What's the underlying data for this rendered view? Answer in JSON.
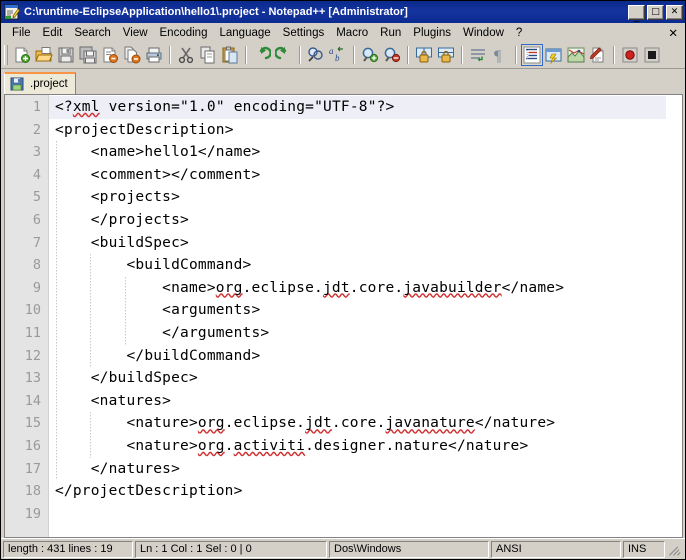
{
  "window": {
    "title": "C:\\runtime-EclipseApplication\\hello1\\.project - Notepad++ [Administrator]",
    "icon": "notepad-plus-plus-icon",
    "minimize_label": "_",
    "maximize_label": "□",
    "close_label": "✕",
    "titlebar_color": "#0a246a"
  },
  "menubar": {
    "items": [
      {
        "label": "File"
      },
      {
        "label": "Edit"
      },
      {
        "label": "Search"
      },
      {
        "label": "View"
      },
      {
        "label": "Encoding"
      },
      {
        "label": "Language"
      },
      {
        "label": "Settings"
      },
      {
        "label": "Macro"
      },
      {
        "label": "Run"
      },
      {
        "label": "Plugins"
      },
      {
        "label": "Window"
      },
      {
        "label": "?"
      }
    ],
    "close_document_label": "✕"
  },
  "toolbar": {
    "buttons": [
      {
        "name": "new-file-icon",
        "title": "New"
      },
      {
        "name": "open-file-icon",
        "title": "Open"
      },
      {
        "name": "save-icon",
        "title": "Save"
      },
      {
        "name": "save-all-icon",
        "title": "Save All"
      },
      {
        "name": "close-file-icon",
        "title": "Close"
      },
      {
        "name": "close-all-files-icon",
        "title": "Close All"
      },
      {
        "name": "print-icon",
        "title": "Print"
      },
      {
        "name": "cut-icon",
        "title": "Cut"
      },
      {
        "name": "copy-icon",
        "title": "Copy"
      },
      {
        "name": "paste-icon",
        "title": "Paste"
      },
      {
        "name": "undo-icon",
        "title": "Undo"
      },
      {
        "name": "redo-icon",
        "title": "Redo"
      },
      {
        "name": "find-icon",
        "title": "Find"
      },
      {
        "name": "replace-icon",
        "title": "Replace"
      },
      {
        "name": "zoom-in-icon",
        "title": "Zoom In"
      },
      {
        "name": "zoom-out-icon",
        "title": "Zoom Out"
      },
      {
        "name": "sync-vertical-scroll-icon",
        "title": "Synchronize Vertical Scrolling"
      },
      {
        "name": "sync-horizontal-scroll-icon",
        "title": "Synchronize Horizontal Scrolling"
      },
      {
        "name": "word-wrap-icon",
        "title": "Word wrap"
      },
      {
        "name": "show-all-characters-icon",
        "title": "Show All Characters"
      },
      {
        "name": "indent-guideline-icon",
        "title": "Show Indent Guide"
      },
      {
        "name": "user-defined-dialog-icon",
        "title": "User-Defined Dialogue"
      },
      {
        "name": "document-map-icon",
        "title": "Document Map"
      },
      {
        "name": "function-list-icon",
        "title": "Function List"
      },
      {
        "name": "start-record-macro-icon",
        "title": "Start Recording"
      },
      {
        "name": "stop-record-macro-icon",
        "title": "Stop Recording"
      }
    ]
  },
  "tabs": [
    {
      "label": ".project",
      "icon": "saved-document-icon",
      "active": true
    }
  ],
  "editor": {
    "current_line": 1,
    "current_line_highlight_color": "#eeeef7",
    "gutter_background": "#e4e4e4",
    "lines": [
      {
        "num": "1",
        "text": "<?xml version=\"1.0\" encoding=\"UTF-8\"?>",
        "indent": 0
      },
      {
        "num": "2",
        "text": "<projectDescription>",
        "indent": 0
      },
      {
        "num": "3",
        "text": "    <name>hello1</name>",
        "indent": 1
      },
      {
        "num": "4",
        "text": "    <comment></comment>",
        "indent": 1
      },
      {
        "num": "5",
        "text": "    <projects>",
        "indent": 1
      },
      {
        "num": "6",
        "text": "    </projects>",
        "indent": 1
      },
      {
        "num": "7",
        "text": "    <buildSpec>",
        "indent": 1
      },
      {
        "num": "8",
        "text": "        <buildCommand>",
        "indent": 2
      },
      {
        "num": "9",
        "text": "            <name>org.eclipse.jdt.core.javabuilder</name>",
        "indent": 3
      },
      {
        "num": "10",
        "text": "            <arguments>",
        "indent": 3
      },
      {
        "num": "11",
        "text": "            </arguments>",
        "indent": 3
      },
      {
        "num": "12",
        "text": "        </buildCommand>",
        "indent": 2
      },
      {
        "num": "13",
        "text": "    </buildSpec>",
        "indent": 1
      },
      {
        "num": "14",
        "text": "    <natures>",
        "indent": 1
      },
      {
        "num": "15",
        "text": "        <nature>org.eclipse.jdt.core.javanature</nature>",
        "indent": 2
      },
      {
        "num": "16",
        "text": "        <nature>org.activiti.designer.nature</nature>",
        "indent": 2
      },
      {
        "num": "17",
        "text": "    </natures>",
        "indent": 1
      },
      {
        "num": "18",
        "text": "</projectDescription>",
        "indent": 0
      },
      {
        "num": "19",
        "text": "",
        "indent": 0
      }
    ]
  },
  "statusbar": {
    "length_lines": "length : 431    lines : 19",
    "caret": "Ln : 1    Col : 1    Sel : 0 | 0",
    "eol": "Dos\\Windows",
    "encoding": "ANSI",
    "insert_mode": "INS"
  }
}
